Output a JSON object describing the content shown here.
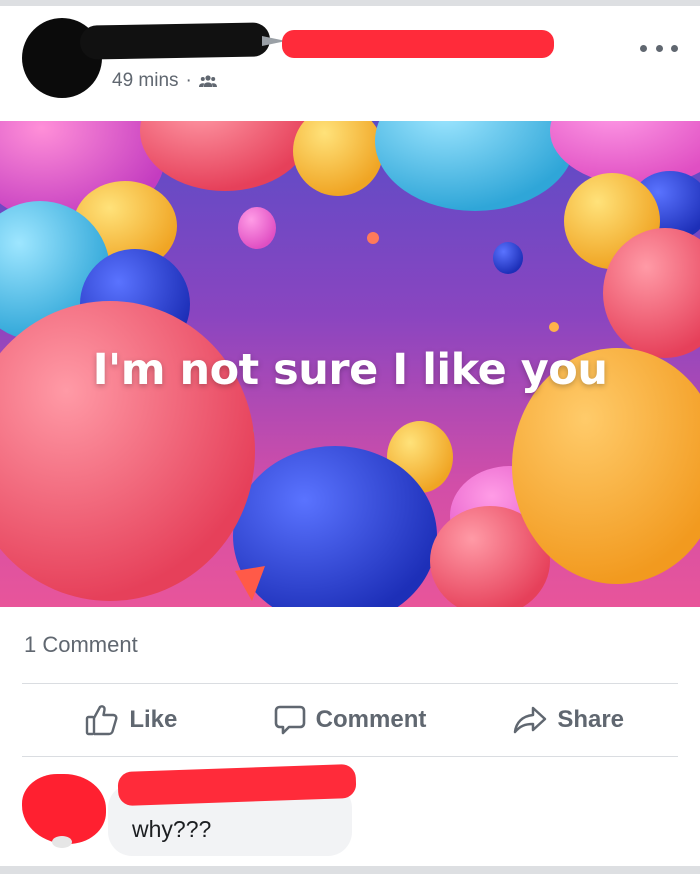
{
  "post": {
    "timestamp": "49 mins",
    "separator": "·",
    "audience_icon": "friends-icon",
    "image_caption": "I'm not sure I like you",
    "comment_count": "1 Comment"
  },
  "actions": {
    "like": "Like",
    "comment": "Comment",
    "share": "Share"
  },
  "comments": [
    {
      "text": "why???"
    }
  ],
  "colors": {
    "meta_text": "#606770",
    "redaction_red": "#ff2b3a",
    "divider": "#dadde1",
    "bubble": "#f2f3f5"
  }
}
